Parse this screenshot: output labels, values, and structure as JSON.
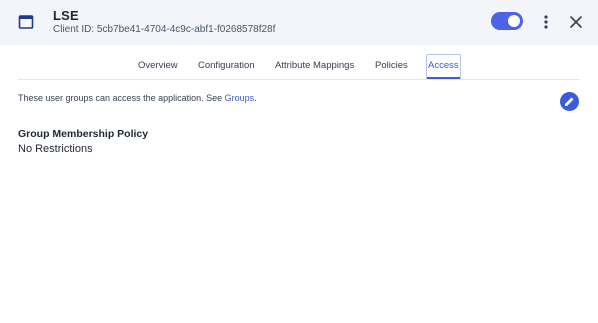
{
  "app": {
    "title": "LSE",
    "client_id": "Client ID: 5cb7be41-4704-4c9c-abf1-f0268578f28f",
    "enabled": true,
    "icon": "window-icon"
  },
  "colors": {
    "accent": "#3b5bdb",
    "header_bg": "#f4f5fb"
  },
  "tabs": [
    {
      "label": "Overview"
    },
    {
      "label": "Configuration"
    },
    {
      "label": "Attribute Mappings"
    },
    {
      "label": "Policies"
    },
    {
      "label": "Access",
      "active": true
    }
  ],
  "access": {
    "info_text": "These user groups can access the application. See ",
    "groups_link": "Groups",
    "info_suffix": ".",
    "policy_heading": "Group Membership Policy",
    "policy_value": "No Restrictions"
  }
}
